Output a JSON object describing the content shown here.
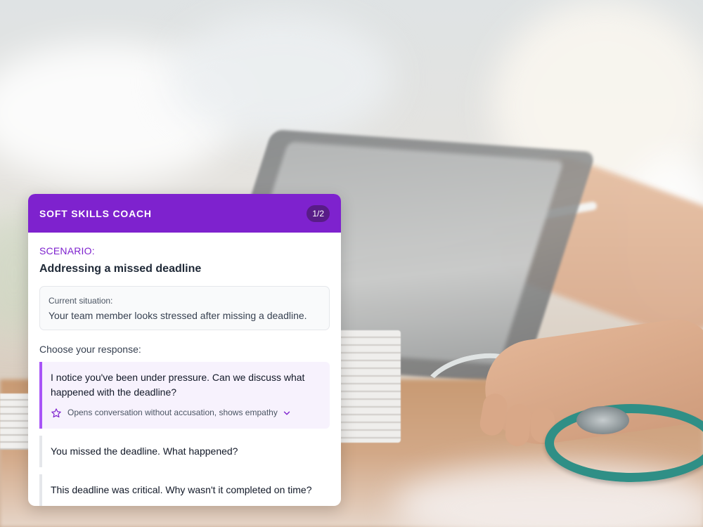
{
  "coach": {
    "title": "SOFT SKILLS COACH",
    "step": "1/2"
  },
  "scenario": {
    "label": "SCENARIO:",
    "title": "Addressing a missed deadline"
  },
  "situation": {
    "label": "Current situation:",
    "text": "Your team member looks stressed after missing a deadline."
  },
  "choose_label": "Choose your response:",
  "options": [
    {
      "text": "I notice you've been under pressure. Can we discuss what happened with the deadline?",
      "feedback": "Opens conversation without accusation, shows empathy",
      "selected": true
    },
    {
      "text": "You missed the deadline. What happened?",
      "selected": false
    },
    {
      "text": "This deadline was critical. Why wasn't it completed on time?",
      "selected": false
    }
  ],
  "colors": {
    "accent": "#7e22ce",
    "accent_dark": "#581c87",
    "selected_bg": "#f7f2fd",
    "selected_border": "#a855f7"
  },
  "icons": {
    "feedback": "star-outline-icon",
    "expand": "chevron-down-icon"
  }
}
